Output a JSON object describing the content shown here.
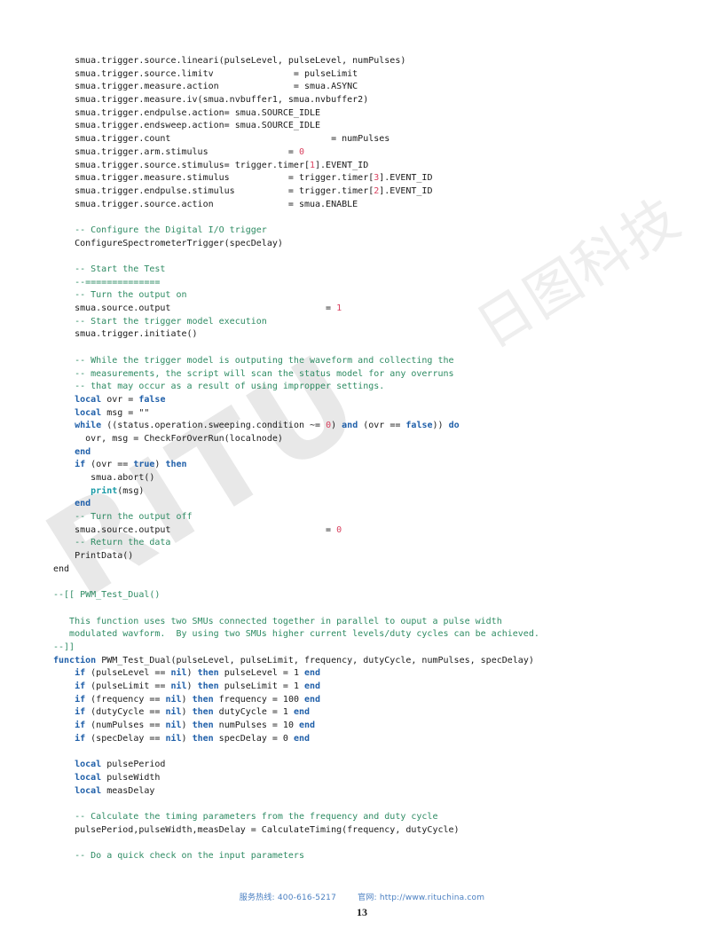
{
  "document": {
    "page_number": "13",
    "language": "lua"
  },
  "watermark": {
    "latin_text": "RITU",
    "cjk_text": "日图科技"
  },
  "footer": {
    "hotline_label": "服务热线:",
    "hotline_value": "400-616-5217",
    "website_label": "官网:",
    "website_value": "http://www.rituchina.com"
  },
  "colors": {
    "comment": "#2e8b63",
    "keyword": "#1f5fa9",
    "number": "#d9415f",
    "builtin": "#1a9aa6",
    "plain": "#1a1a1a",
    "footer_link": "#4a7fc1",
    "watermark": "#e8e8e8"
  },
  "code": {
    "lines": [
      {
        "id": "l1",
        "segments": [
          {
            "t": "    smua.trigger.source.lineari(pulseLevel, pulseLevel, numPulses)",
            "c": "p"
          }
        ]
      },
      {
        "id": "l2",
        "segments": [
          {
            "t": "    smua.trigger.source.limitv               = pulseLimit",
            "c": "p"
          }
        ]
      },
      {
        "id": "l3",
        "segments": [
          {
            "t": "    smua.trigger.measure.action              = smua.ASYNC",
            "c": "p"
          }
        ]
      },
      {
        "id": "l4",
        "segments": [
          {
            "t": "    smua.trigger.measure.iv(smua.nvbuffer1, smua.nvbuffer2)",
            "c": "p"
          }
        ]
      },
      {
        "id": "l5",
        "segments": [
          {
            "t": "    smua.trigger.endpulse.action= smua.SOURCE_IDLE",
            "c": "p"
          }
        ]
      },
      {
        "id": "l6",
        "segments": [
          {
            "t": "    smua.trigger.endsweep.action= smua.SOURCE_IDLE",
            "c": "p"
          }
        ]
      },
      {
        "id": "l7",
        "segments": [
          {
            "t": "    smua.trigger.count                              = numPulses",
            "c": "p"
          }
        ]
      },
      {
        "id": "l8",
        "segments": [
          {
            "t": "    smua.trigger.arm.stimulus               = ",
            "c": "p"
          },
          {
            "t": "0",
            "c": "n"
          }
        ]
      },
      {
        "id": "l9",
        "segments": [
          {
            "t": "    smua.trigger.source.stimulus= trigger.timer[",
            "c": "p"
          },
          {
            "t": "1",
            "c": "n"
          },
          {
            "t": "].EVENT_ID",
            "c": "p"
          }
        ]
      },
      {
        "id": "l10",
        "segments": [
          {
            "t": "    smua.trigger.measure.stimulus           = trigger.timer[",
            "c": "p"
          },
          {
            "t": "3",
            "c": "n"
          },
          {
            "t": "].EVENT_ID",
            "c": "p"
          }
        ]
      },
      {
        "id": "l11",
        "segments": [
          {
            "t": "    smua.trigger.endpulse.stimulus          = trigger.timer[",
            "c": "p"
          },
          {
            "t": "2",
            "c": "n"
          },
          {
            "t": "].EVENT_ID",
            "c": "p"
          }
        ]
      },
      {
        "id": "l12",
        "segments": [
          {
            "t": "    smua.trigger.source.action              = smua.ENABLE",
            "c": "p"
          }
        ]
      },
      {
        "id": "l13",
        "segments": []
      },
      {
        "id": "l14",
        "segments": [
          {
            "t": "    -- Configure the Digital I/O trigger",
            "c": "c"
          }
        ]
      },
      {
        "id": "l15",
        "segments": [
          {
            "t": "    ConfigureSpectrometerTrigger(specDelay)",
            "c": "p"
          }
        ]
      },
      {
        "id": "l16",
        "segments": []
      },
      {
        "id": "l17",
        "segments": [
          {
            "t": "    -- Start the Test",
            "c": "c"
          }
        ]
      },
      {
        "id": "l18",
        "segments": [
          {
            "t": "    --==============",
            "c": "c"
          }
        ]
      },
      {
        "id": "l19",
        "segments": [
          {
            "t": "    -- Turn the output on",
            "c": "c"
          }
        ]
      },
      {
        "id": "l20",
        "segments": [
          {
            "t": "    smua.source.output                             = ",
            "c": "p"
          },
          {
            "t": "1",
            "c": "n"
          }
        ]
      },
      {
        "id": "l21",
        "segments": [
          {
            "t": "    -- Start the trigger model execution",
            "c": "c"
          }
        ]
      },
      {
        "id": "l22",
        "segments": [
          {
            "t": "    smua.trigger.initiate()",
            "c": "p"
          }
        ]
      },
      {
        "id": "l23",
        "segments": []
      },
      {
        "id": "l24",
        "segments": [
          {
            "t": "    -- While the trigger model is outputing the waveform and collecting the",
            "c": "c"
          }
        ]
      },
      {
        "id": "l25",
        "segments": [
          {
            "t": "    -- measurements, the script will scan the status model for any overruns",
            "c": "c"
          }
        ]
      },
      {
        "id": "l26",
        "segments": [
          {
            "t": "    -- that may occur as a result of using impropper settings.",
            "c": "c"
          }
        ]
      },
      {
        "id": "l27",
        "segments": [
          {
            "t": "    ",
            "c": "p"
          },
          {
            "t": "local",
            "c": "k"
          },
          {
            "t": " ovr = ",
            "c": "p"
          },
          {
            "t": "false",
            "c": "k"
          }
        ]
      },
      {
        "id": "l28",
        "segments": [
          {
            "t": "    ",
            "c": "p"
          },
          {
            "t": "local",
            "c": "k"
          },
          {
            "t": " msg = \"\"",
            "c": "p"
          }
        ]
      },
      {
        "id": "l29",
        "segments": [
          {
            "t": "    ",
            "c": "p"
          },
          {
            "t": "while",
            "c": "k"
          },
          {
            "t": " ((status.operation.sweeping.condition ~= ",
            "c": "p"
          },
          {
            "t": "0",
            "c": "n"
          },
          {
            "t": ") ",
            "c": "p"
          },
          {
            "t": "and",
            "c": "k"
          },
          {
            "t": " (ovr == ",
            "c": "p"
          },
          {
            "t": "false",
            "c": "k"
          },
          {
            "t": ")) ",
            "c": "p"
          },
          {
            "t": "do",
            "c": "k"
          }
        ]
      },
      {
        "id": "l30",
        "segments": [
          {
            "t": "      ovr, msg = CheckForOverRun(localnode)",
            "c": "p"
          }
        ]
      },
      {
        "id": "l31",
        "segments": [
          {
            "t": "    ",
            "c": "p"
          },
          {
            "t": "end",
            "c": "k"
          }
        ]
      },
      {
        "id": "l32",
        "segments": [
          {
            "t": "    ",
            "c": "p"
          },
          {
            "t": "if",
            "c": "k"
          },
          {
            "t": " (ovr == ",
            "c": "p"
          },
          {
            "t": "true",
            "c": "k"
          },
          {
            "t": ") ",
            "c": "p"
          },
          {
            "t": "then",
            "c": "k"
          }
        ]
      },
      {
        "id": "l33",
        "segments": [
          {
            "t": "       smua.abort()",
            "c": "p"
          }
        ]
      },
      {
        "id": "l34",
        "segments": [
          {
            "t": "       ",
            "c": "p"
          },
          {
            "t": "print",
            "c": "f"
          },
          {
            "t": "(msg)",
            "c": "p"
          }
        ]
      },
      {
        "id": "l35",
        "segments": [
          {
            "t": "    ",
            "c": "p"
          },
          {
            "t": "end",
            "c": "k"
          }
        ]
      },
      {
        "id": "l36",
        "segments": [
          {
            "t": "    -- Turn the output off",
            "c": "c"
          }
        ]
      },
      {
        "id": "l37",
        "segments": [
          {
            "t": "    smua.source.output                             = ",
            "c": "p"
          },
          {
            "t": "0",
            "c": "n"
          }
        ]
      },
      {
        "id": "l38",
        "segments": [
          {
            "t": "    -- Return the data",
            "c": "c"
          }
        ]
      },
      {
        "id": "l39",
        "segments": [
          {
            "t": "    PrintData()",
            "c": "p"
          }
        ]
      },
      {
        "id": "l40",
        "segments": [
          {
            "t": "end",
            "c": "p"
          }
        ]
      },
      {
        "id": "l41",
        "segments": []
      },
      {
        "id": "l42",
        "segments": [
          {
            "t": "--[[ PWM_Test_Dual()",
            "c": "c"
          }
        ]
      },
      {
        "id": "l43",
        "segments": []
      },
      {
        "id": "l44",
        "segments": [
          {
            "t": "   This function uses two SMUs connected together in parallel to ouput a pulse width",
            "c": "c"
          }
        ]
      },
      {
        "id": "l45",
        "segments": [
          {
            "t": "   modulated wavform.  By using two SMUs higher current levels/duty cycles can be achieved.",
            "c": "c"
          }
        ]
      },
      {
        "id": "l46",
        "segments": [
          {
            "t": "--]]",
            "c": "c"
          }
        ]
      },
      {
        "id": "l47",
        "segments": [
          {
            "t": "function",
            "c": "k"
          },
          {
            "t": " PWM_Test_Dual(pulseLevel, pulseLimit, frequency, dutyCycle, numPulses, specDelay)",
            "c": "p"
          }
        ]
      },
      {
        "id": "l48",
        "segments": [
          {
            "t": "    ",
            "c": "p"
          },
          {
            "t": "if",
            "c": "k"
          },
          {
            "t": " (pulseLevel == ",
            "c": "p"
          },
          {
            "t": "nil",
            "c": "k"
          },
          {
            "t": ") ",
            "c": "p"
          },
          {
            "t": "then",
            "c": "k"
          },
          {
            "t": " pulseLevel = 1 ",
            "c": "p"
          },
          {
            "t": "end",
            "c": "k"
          }
        ]
      },
      {
        "id": "l49",
        "segments": [
          {
            "t": "    ",
            "c": "p"
          },
          {
            "t": "if",
            "c": "k"
          },
          {
            "t": " (pulseLimit == ",
            "c": "p"
          },
          {
            "t": "nil",
            "c": "k"
          },
          {
            "t": ") ",
            "c": "p"
          },
          {
            "t": "then",
            "c": "k"
          },
          {
            "t": " pulseLimit = 1 ",
            "c": "p"
          },
          {
            "t": "end",
            "c": "k"
          }
        ]
      },
      {
        "id": "l50",
        "segments": [
          {
            "t": "    ",
            "c": "p"
          },
          {
            "t": "if",
            "c": "k"
          },
          {
            "t": " (frequency == ",
            "c": "p"
          },
          {
            "t": "nil",
            "c": "k"
          },
          {
            "t": ") ",
            "c": "p"
          },
          {
            "t": "then",
            "c": "k"
          },
          {
            "t": " frequency = 100 ",
            "c": "p"
          },
          {
            "t": "end",
            "c": "k"
          }
        ]
      },
      {
        "id": "l51",
        "segments": [
          {
            "t": "    ",
            "c": "p"
          },
          {
            "t": "if",
            "c": "k"
          },
          {
            "t": " (dutyCycle == ",
            "c": "p"
          },
          {
            "t": "nil",
            "c": "k"
          },
          {
            "t": ") ",
            "c": "p"
          },
          {
            "t": "then",
            "c": "k"
          },
          {
            "t": " dutyCycle = 1 ",
            "c": "p"
          },
          {
            "t": "end",
            "c": "k"
          }
        ]
      },
      {
        "id": "l52",
        "segments": [
          {
            "t": "    ",
            "c": "p"
          },
          {
            "t": "if",
            "c": "k"
          },
          {
            "t": " (numPulses == ",
            "c": "p"
          },
          {
            "t": "nil",
            "c": "k"
          },
          {
            "t": ") ",
            "c": "p"
          },
          {
            "t": "then",
            "c": "k"
          },
          {
            "t": " numPulses = 10 ",
            "c": "p"
          },
          {
            "t": "end",
            "c": "k"
          }
        ]
      },
      {
        "id": "l53",
        "segments": [
          {
            "t": "    ",
            "c": "p"
          },
          {
            "t": "if",
            "c": "k"
          },
          {
            "t": " (specDelay == ",
            "c": "p"
          },
          {
            "t": "nil",
            "c": "k"
          },
          {
            "t": ") ",
            "c": "p"
          },
          {
            "t": "then",
            "c": "k"
          },
          {
            "t": " specDelay = 0 ",
            "c": "p"
          },
          {
            "t": "end",
            "c": "k"
          }
        ]
      },
      {
        "id": "l54",
        "segments": []
      },
      {
        "id": "l55",
        "segments": [
          {
            "t": "    ",
            "c": "p"
          },
          {
            "t": "local",
            "c": "k"
          },
          {
            "t": " pulsePeriod",
            "c": "p"
          }
        ]
      },
      {
        "id": "l56",
        "segments": [
          {
            "t": "    ",
            "c": "p"
          },
          {
            "t": "local",
            "c": "k"
          },
          {
            "t": " pulseWidth",
            "c": "p"
          }
        ]
      },
      {
        "id": "l57",
        "segments": [
          {
            "t": "    ",
            "c": "p"
          },
          {
            "t": "local",
            "c": "k"
          },
          {
            "t": " measDelay",
            "c": "p"
          }
        ]
      },
      {
        "id": "l58",
        "segments": []
      },
      {
        "id": "l59",
        "segments": [
          {
            "t": "    -- Calculate the timing parameters from the frequency and duty cycle",
            "c": "c"
          }
        ]
      },
      {
        "id": "l60",
        "segments": [
          {
            "t": "    pulsePeriod,pulseWidth,measDelay = CalculateTiming(frequency, dutyCycle)",
            "c": "p"
          }
        ]
      },
      {
        "id": "l61",
        "segments": []
      },
      {
        "id": "l62",
        "segments": [
          {
            "t": "    -- Do a quick check on the input parameters",
            "c": "c"
          }
        ]
      }
    ]
  }
}
